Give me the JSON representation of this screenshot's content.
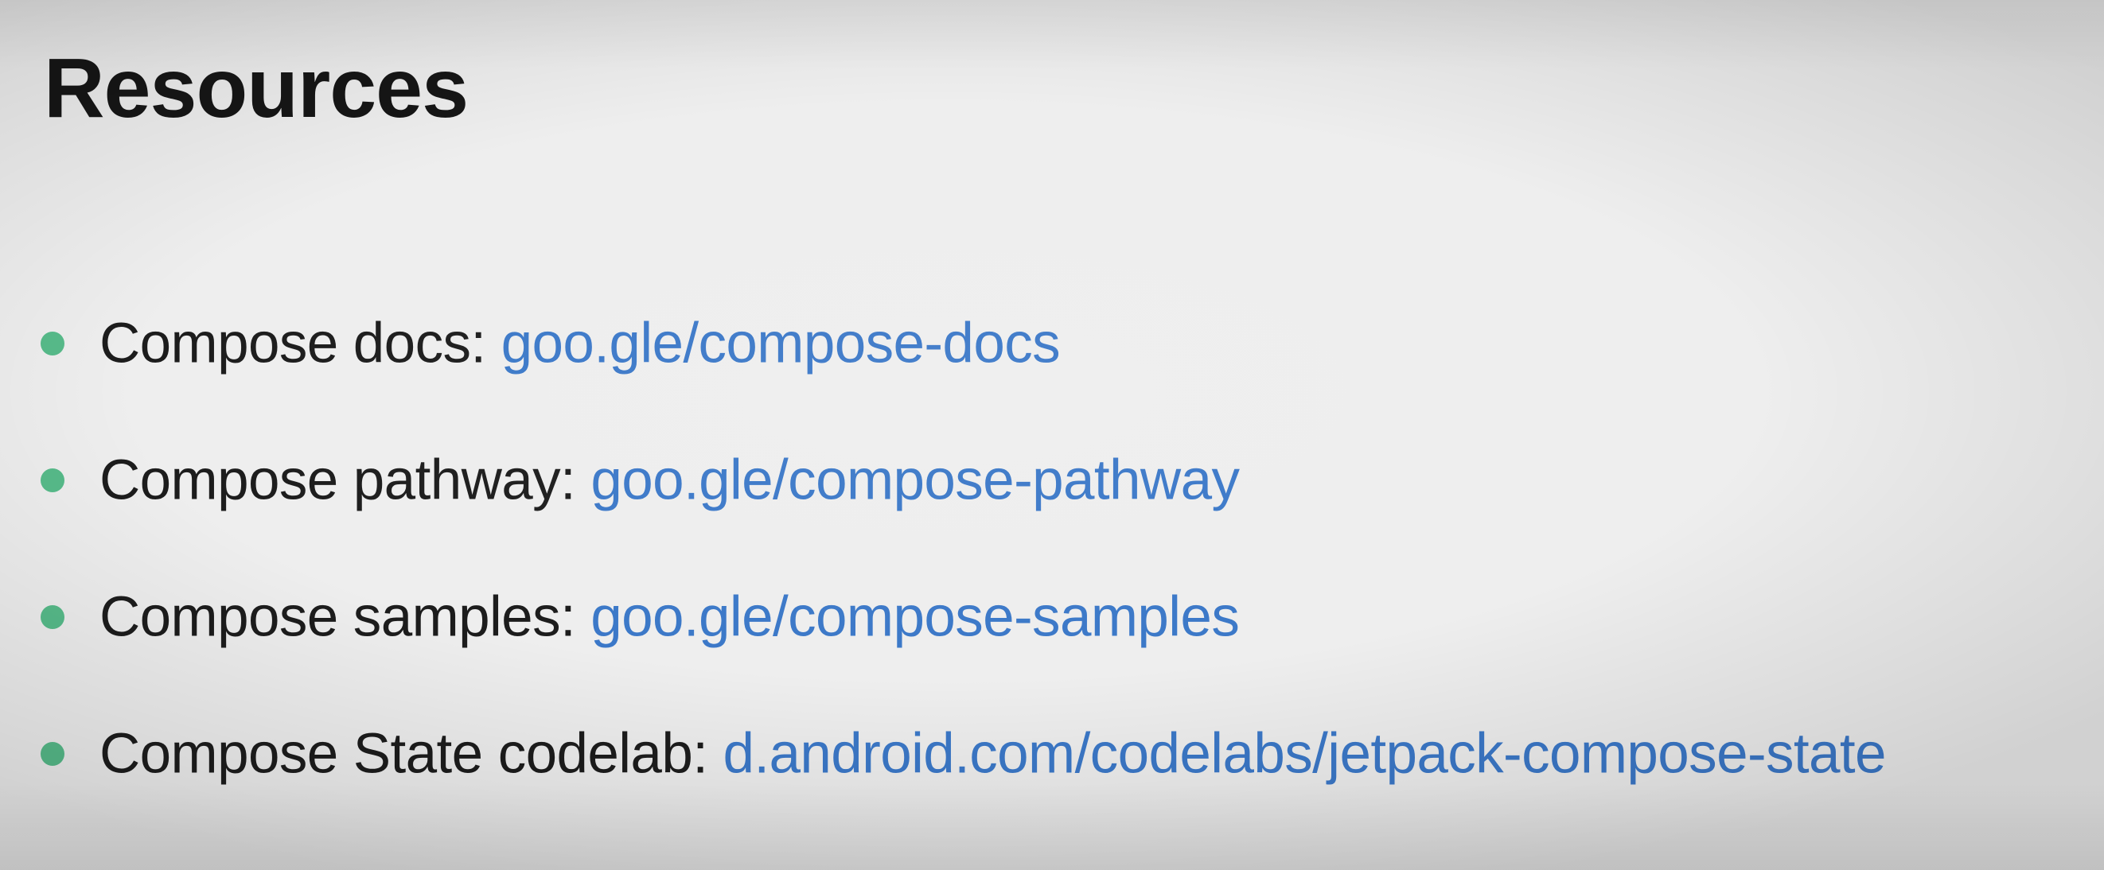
{
  "slide": {
    "title": "Resources",
    "items": [
      {
        "label": "Compose docs:",
        "link": "goo.gle/compose-docs"
      },
      {
        "label": "Compose pathway:",
        "link": "goo.gle/compose-pathway"
      },
      {
        "label": "Compose samples:",
        "link": "goo.gle/compose-samples"
      },
      {
        "label": "Compose State codelab:",
        "link": "d.android.com/codelabs/jetpack-compose-state"
      }
    ]
  },
  "colors": {
    "background": "#eeeeee",
    "text": "#1c1c1c",
    "link": "#3b78c8",
    "bullet": "#57bb8a"
  }
}
